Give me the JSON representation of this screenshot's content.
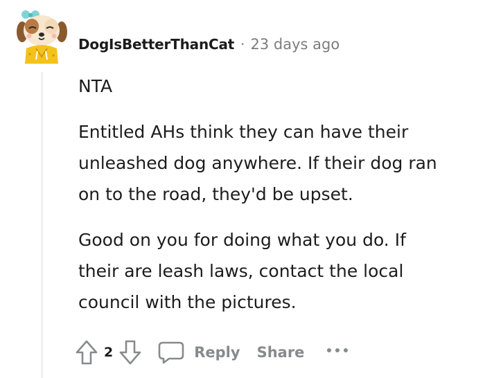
{
  "comment": {
    "username": "DogIsBetterThanCat",
    "separator": "·",
    "timestamp": "23 days ago",
    "paragraphs": [
      [
        "NTA"
      ],
      [
        "Entitled AHs think they can have their",
        "unleashed dog anywhere. If their dog ran",
        "on to the road, they'd be upset."
      ],
      [
        "Good on you for doing what you do. If",
        "their are leash laws, contact the local",
        "council with the pictures."
      ]
    ]
  },
  "actions": {
    "vote_count": "2",
    "reply_label": "Reply",
    "share_label": "Share",
    "upvote_icon": "arrow-up-outline-icon",
    "downvote_icon": "arrow-down-outline-icon",
    "reply_icon": "speech-bubble-icon",
    "more_icon": "ellipsis-icon"
  },
  "colors": {
    "text": "#1c1c1c",
    "meta": "#7c7c7c",
    "action": "#878a8c",
    "thread_line": "#edeff1"
  }
}
